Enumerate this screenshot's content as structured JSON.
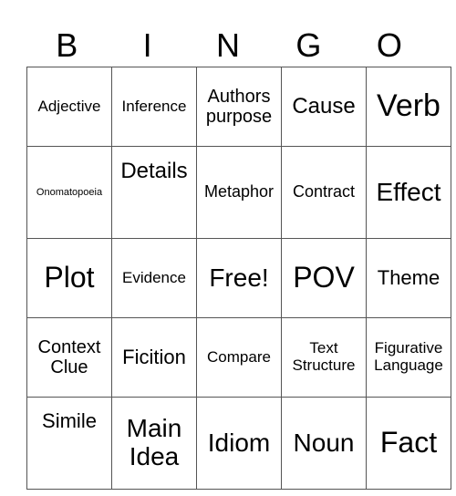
{
  "header": [
    "B",
    "I",
    "N",
    "G",
    "O"
  ],
  "rows": [
    [
      "Adjective",
      "Inference",
      "Authors purpose",
      "Cause",
      "Verb"
    ],
    [
      "Onomatopoeia",
      "Details",
      "Metaphor",
      "Contract",
      "Effect"
    ],
    [
      "Plot",
      "Evidence",
      "Free!",
      "POV",
      "Theme"
    ],
    [
      "Context Clue",
      "Ficition",
      "Compare",
      "Text Structure",
      "Figurative Language"
    ],
    [
      "Simile",
      "Main Idea",
      "Idiom",
      "Noun",
      "Fact"
    ]
  ]
}
